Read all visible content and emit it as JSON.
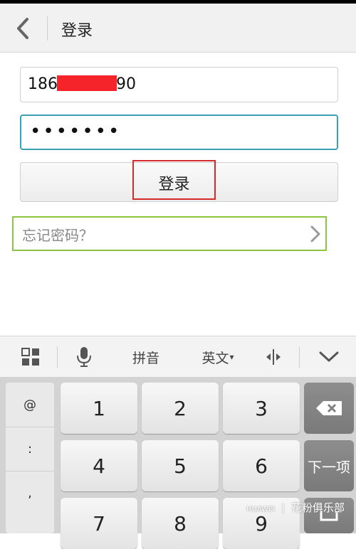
{
  "header": {
    "title": "登录",
    "back_icon": "chevron-left-icon"
  },
  "form": {
    "phone": {
      "prefix": "186",
      "suffix": "90"
    },
    "password": {
      "masked_value": "•••••••"
    },
    "login_button_label": "登录",
    "forgot_password_label": "忘记密码？"
  },
  "keyboard": {
    "toolbar": {
      "grid_icon": "grid-icon",
      "mic_icon": "microphone-icon",
      "pinyin_label": "拼音",
      "language_label": "英文",
      "language_arrow": "▾",
      "cursor_icon": "cursor-move-icon",
      "collapse_icon": "chevron-down-icon"
    },
    "symbols": [
      "@",
      ":",
      ","
    ],
    "keys": [
      "1",
      "2",
      "3",
      "4",
      "5",
      "6",
      "7",
      "8",
      "9"
    ],
    "next_label": "下一项",
    "backspace_icon": "backspace-icon"
  },
  "watermark": {
    "text": "花粉俱乐部",
    "brand": "HUAWEI"
  },
  "colors": {
    "focus_border": "#3aa0b8",
    "redaction": "#f5242b",
    "login_highlight": "#d42a2a",
    "forgot_highlight": "#8cc63f"
  }
}
